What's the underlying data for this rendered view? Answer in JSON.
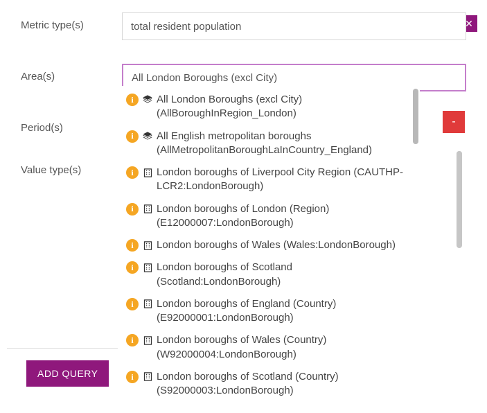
{
  "close_label": "✕",
  "minus_label": "-",
  "rows": {
    "metric_label": "Metric type(s)",
    "metric_value": "total resident population",
    "area_label": "Area(s)",
    "area_value": "All London Boroughs (excl City)",
    "period_label": "Period(s)",
    "value_label": "Value type(s)"
  },
  "add_query_label": "ADD QUERY",
  "dropdown": {
    "items": [
      {
        "icon": "layers",
        "text": "All London Boroughs (excl City) (AllBoroughInRegion_London)"
      },
      {
        "icon": "layers",
        "text": "All English metropolitan boroughs (AllMetropolitanBoroughLaInCountry_England)"
      },
      {
        "icon": "building",
        "text": "London boroughs of Liverpool City Region (CAUTHP-LCR2:LondonBorough)"
      },
      {
        "icon": "building",
        "text": "London boroughs of London (Region) (E12000007:LondonBorough)"
      },
      {
        "icon": "building",
        "text": "London boroughs of Wales (Wales:LondonBorough)"
      },
      {
        "icon": "building",
        "text": "London boroughs of Scotland (Scotland:LondonBorough)"
      },
      {
        "icon": "building",
        "text": "London boroughs of England (Country) (E92000001:LondonBorough)"
      },
      {
        "icon": "building",
        "text": "London boroughs of Wales (Country) (W92000004:LondonBorough)"
      },
      {
        "icon": "building",
        "text": "London boroughs of Scotland (Country) (S92000003:LondonBorough)"
      }
    ]
  }
}
